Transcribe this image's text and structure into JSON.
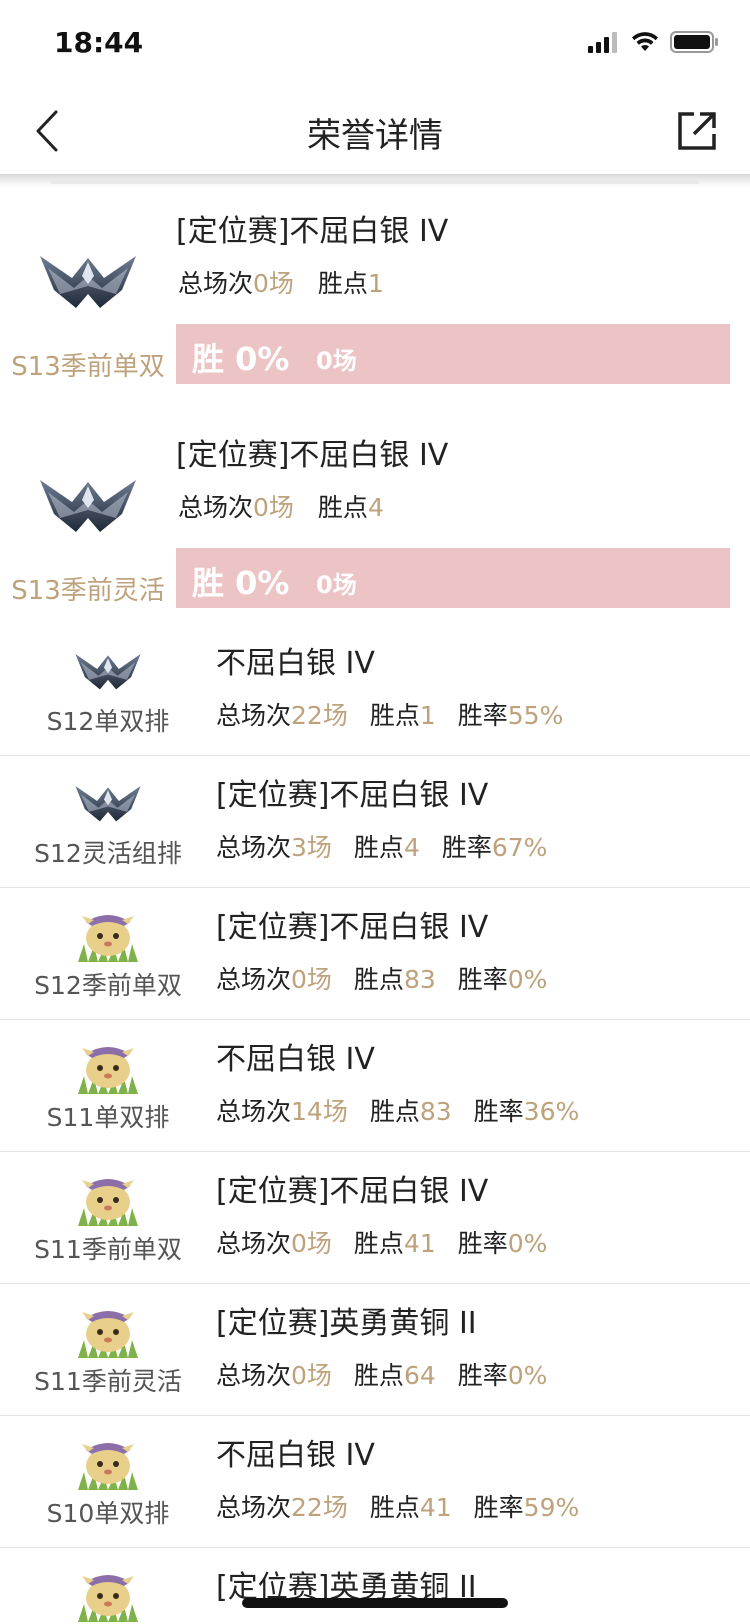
{
  "status_bar": {
    "time": "18:44"
  },
  "nav": {
    "title": "荣誉详情",
    "back_icon": "chevron-left-icon",
    "share_icon": "share-external-icon"
  },
  "labels": {
    "total_games": "总场次",
    "points": "胜点",
    "win_rate": "胜率"
  },
  "big_cards": [
    {
      "season": "S13季前单双",
      "rank": "[定位赛]不屈白银 IV",
      "total": "0场",
      "points": "1",
      "win_label": "胜 0%",
      "win_games": "0场",
      "icon": "silver-wing-emblem-icon",
      "win_fraction": 0
    },
    {
      "season": "S13季前灵活",
      "rank": "[定位赛]不屈白银 IV",
      "total": "0场",
      "points": "4",
      "win_label": "胜 0%",
      "win_games": "0场",
      "icon": "silver-wing-emblem-icon",
      "win_fraction": 0
    }
  ],
  "rows": [
    {
      "season": "S12单双排",
      "rank": "不屈白银 IV",
      "total": "22场",
      "points": "1",
      "rate": "55%",
      "icon": "silver-wing-emblem-icon"
    },
    {
      "season": "S12灵活组排",
      "rank": "[定位赛]不屈白银 IV",
      "total": "3场",
      "points": "4",
      "rate": "67%",
      "icon": "silver-wing-emblem-icon"
    },
    {
      "season": "S12季前单双",
      "rank": "[定位赛]不屈白银 IV",
      "total": "0场",
      "points": "83",
      "rate": "0%",
      "icon": "poro-mascot-icon"
    },
    {
      "season": "S11单双排",
      "rank": "不屈白银 IV",
      "total": "14场",
      "points": "83",
      "rate": "36%",
      "icon": "poro-mascot-icon"
    },
    {
      "season": "S11季前单双",
      "rank": "[定位赛]不屈白银 IV",
      "total": "0场",
      "points": "41",
      "rate": "0%",
      "icon": "poro-mascot-icon"
    },
    {
      "season": "S11季前灵活",
      "rank": "[定位赛]英勇黄铜 II",
      "total": "0场",
      "points": "64",
      "rate": "0%",
      "icon": "poro-mascot-icon"
    },
    {
      "season": "S10单双排",
      "rank": "不屈白银 IV",
      "total": "22场",
      "points": "41",
      "rate": "59%",
      "icon": "poro-mascot-icon"
    },
    {
      "season": "",
      "rank": "[定位赛]英勇黄铜 II",
      "total": "",
      "points": "",
      "rate": "",
      "icon": "poro-mascot-icon"
    }
  ],
  "colors": {
    "accent_gold": "#bda27c",
    "win_bar": "#edc4c6"
  }
}
